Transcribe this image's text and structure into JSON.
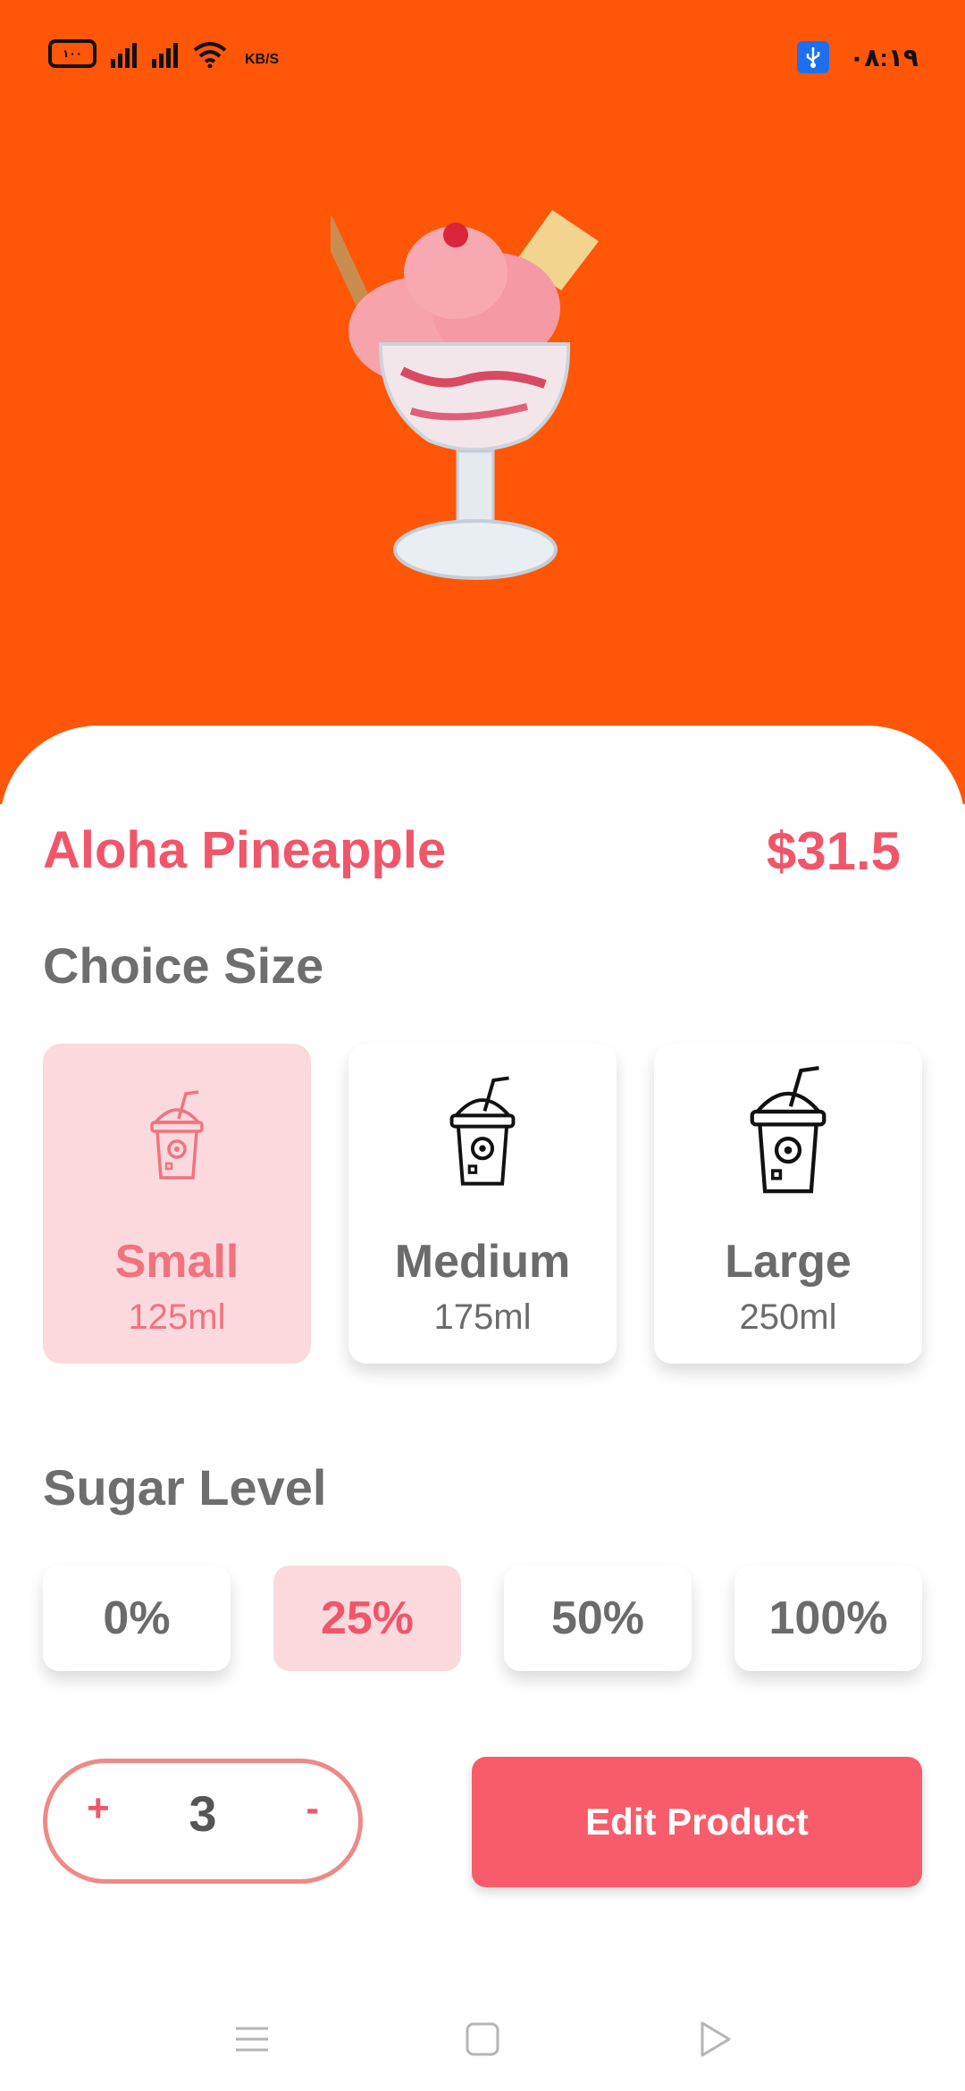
{
  "status_bar": {
    "battery": "۱۰۰",
    "speed_unit": "KB/S",
    "time": "۰۸:۱۹",
    "icons": [
      "battery-icon",
      "signal-icon",
      "signal-icon",
      "wifi-icon",
      "usb-icon"
    ]
  },
  "product": {
    "name": "Aloha Pineapple",
    "price": "$31.5",
    "image": "ice-cream-sundae-image"
  },
  "size_section": {
    "title": "Choice Size",
    "options": [
      {
        "label": "Small",
        "volume": "125ml",
        "selected": true
      },
      {
        "label": "Medium",
        "volume": "175ml",
        "selected": false
      },
      {
        "label": "Large",
        "volume": "250ml",
        "selected": false
      }
    ]
  },
  "sugar_section": {
    "title": "Sugar Level",
    "options": [
      {
        "label": "0%",
        "selected": false
      },
      {
        "label": "25%",
        "selected": true
      },
      {
        "label": "50%",
        "selected": false
      },
      {
        "label": "100%",
        "selected": false
      }
    ]
  },
  "quantity": {
    "plus": "+",
    "value": "3",
    "minus": "-"
  },
  "actions": {
    "edit_label": "Edit Product"
  },
  "nav": {
    "icons": [
      "menu-icon",
      "home-square-icon",
      "back-triangle-icon"
    ]
  },
  "colors": {
    "hero": "#ff5607",
    "accent": "#f0566a",
    "selected_bg": "#fcd9dd",
    "button": "#f85c6a"
  }
}
